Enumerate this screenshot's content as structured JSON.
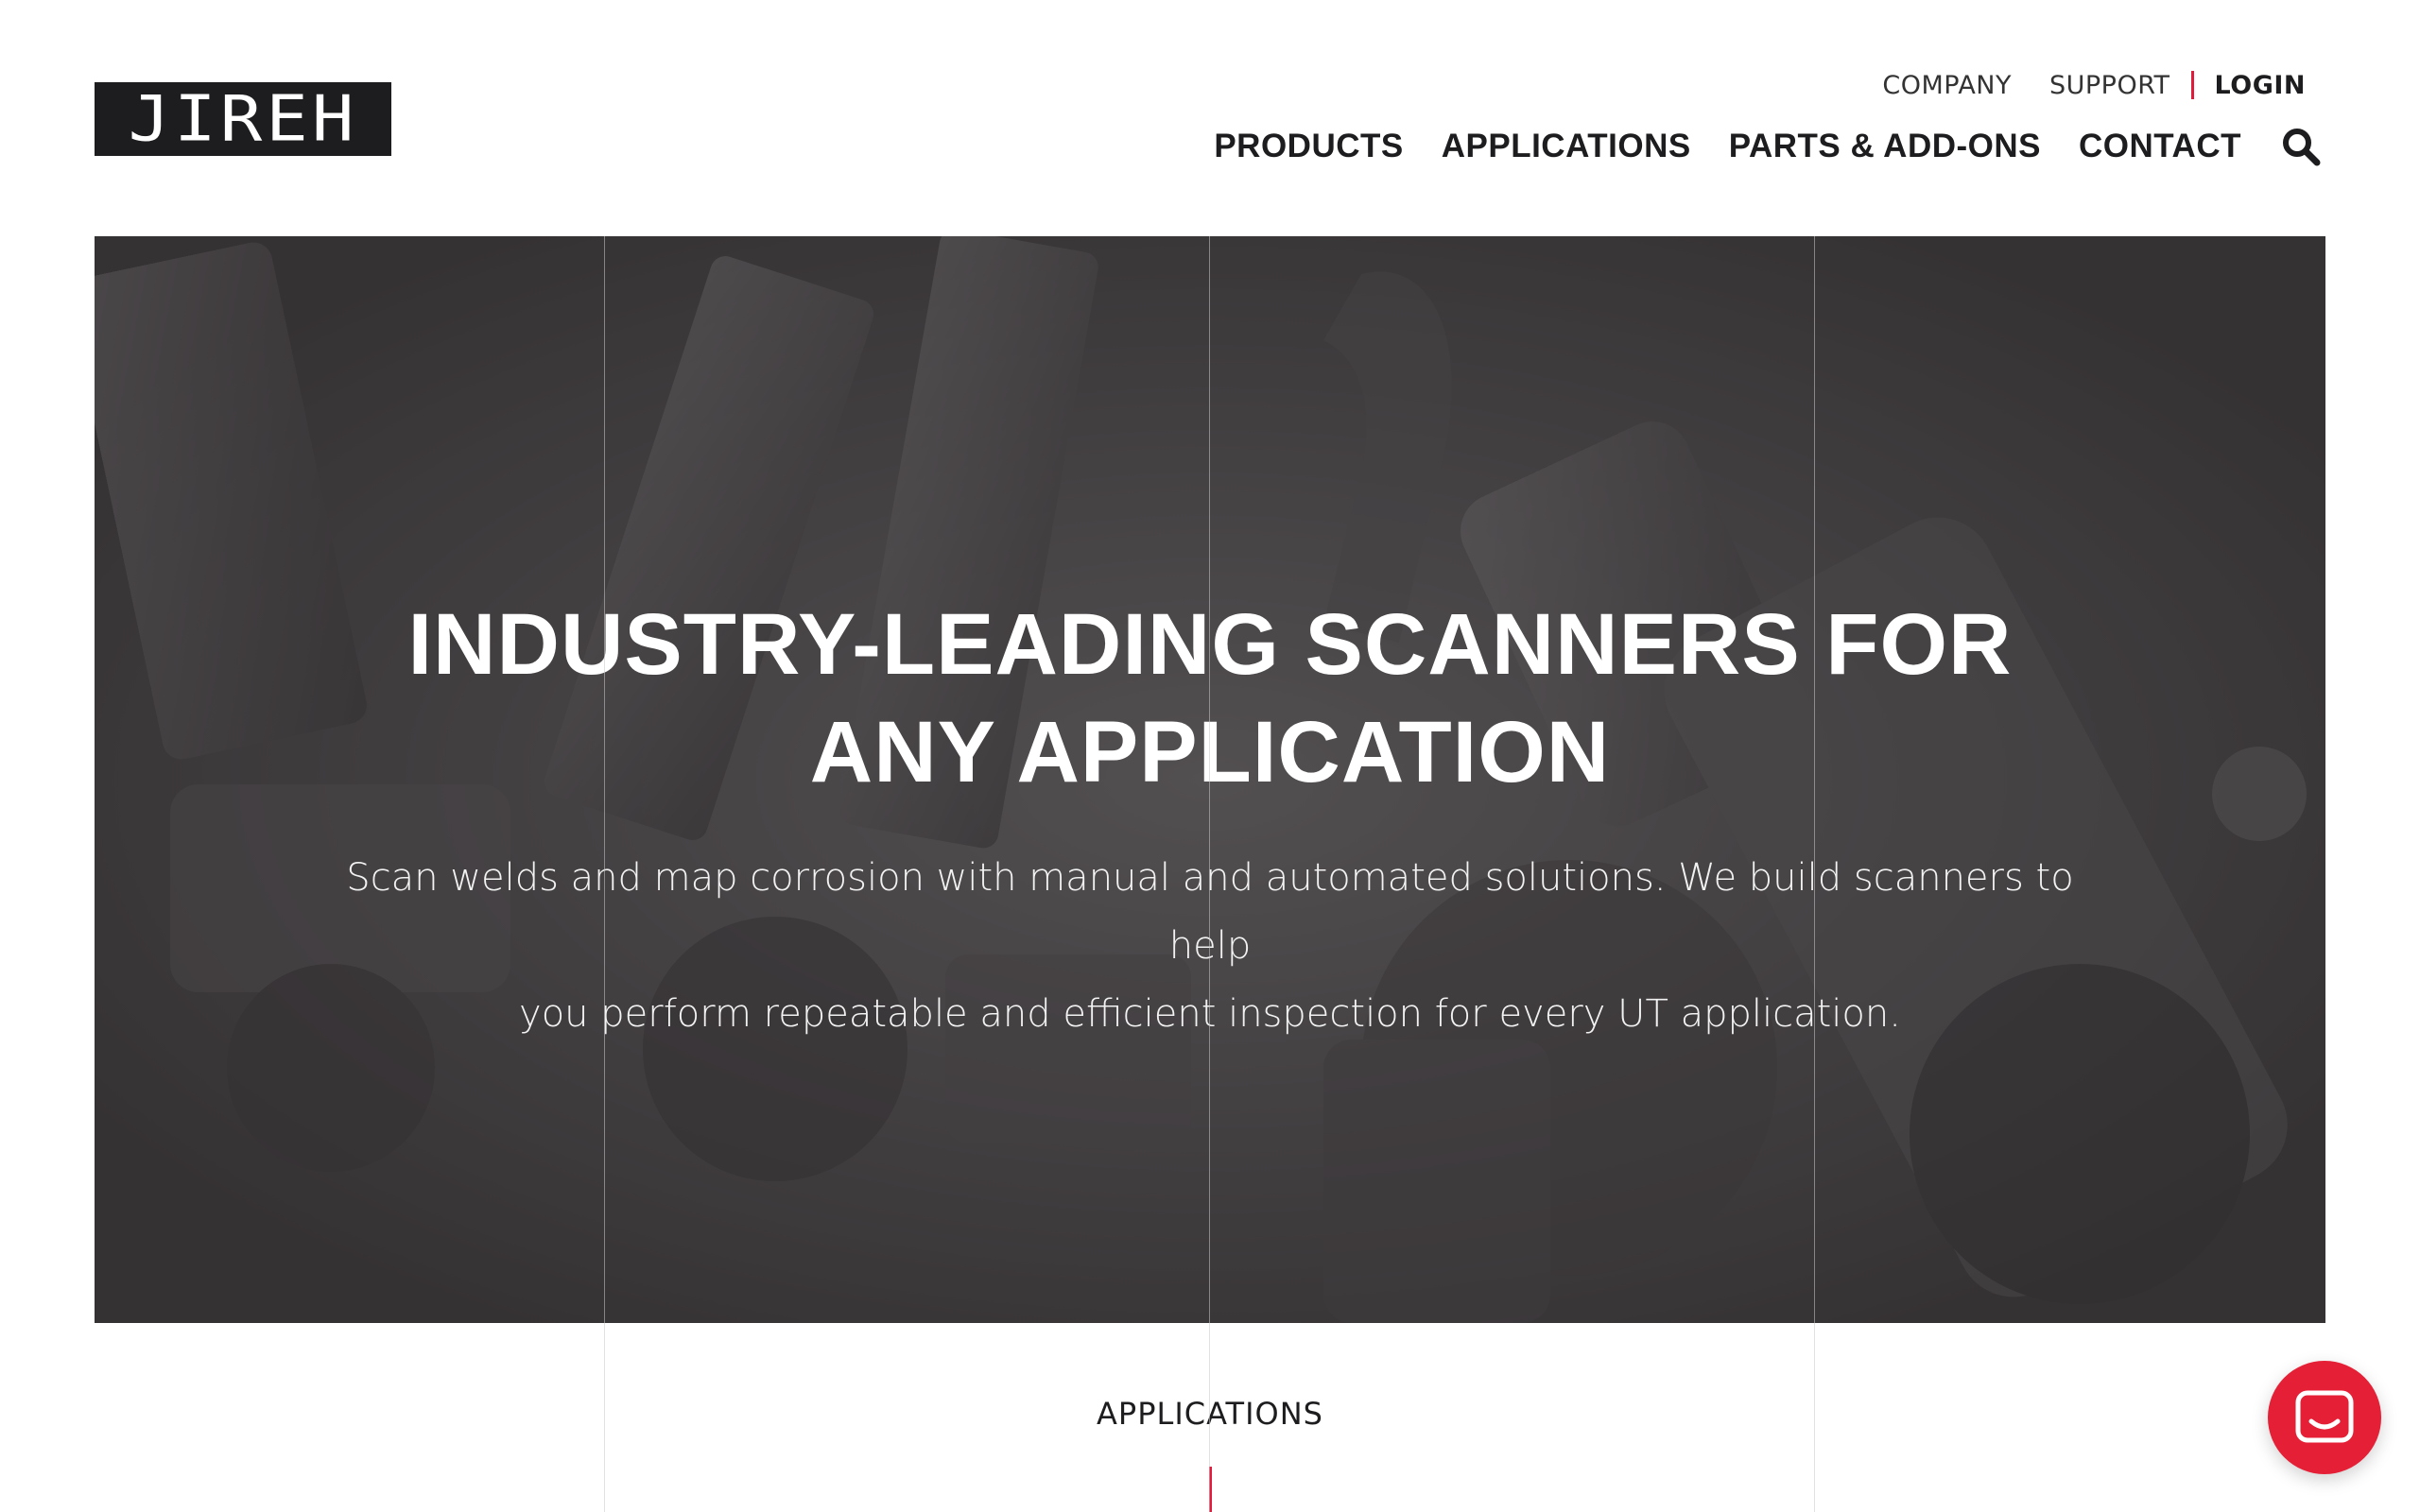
{
  "logo": {
    "text": "JIREH"
  },
  "utility_nav": {
    "company": "COMPANY",
    "support": "SUPPORT",
    "login": "LOGIN"
  },
  "main_nav": {
    "items": [
      "PRODUCTS",
      "APPLICATIONS",
      "PARTS & ADD-ONS",
      "CONTACT"
    ],
    "search_icon": "search-icon"
  },
  "hero": {
    "title_line1": "INDUSTRY-LEADING SCANNERS FOR",
    "title_line2": "ANY APPLICATION",
    "subtitle_line1": "Scan welds and map corrosion with manual and automated solutions. We build scanners to help",
    "subtitle_line2": "you perform repeatable and efficient inspection for every UT application."
  },
  "section": {
    "label": "APPLICATIONS"
  },
  "chat": {
    "icon": "chat-icon"
  },
  "colors": {
    "accent": "#e31b3a",
    "dark": "#1d1d1f",
    "hero_bg": "#4a4748"
  }
}
